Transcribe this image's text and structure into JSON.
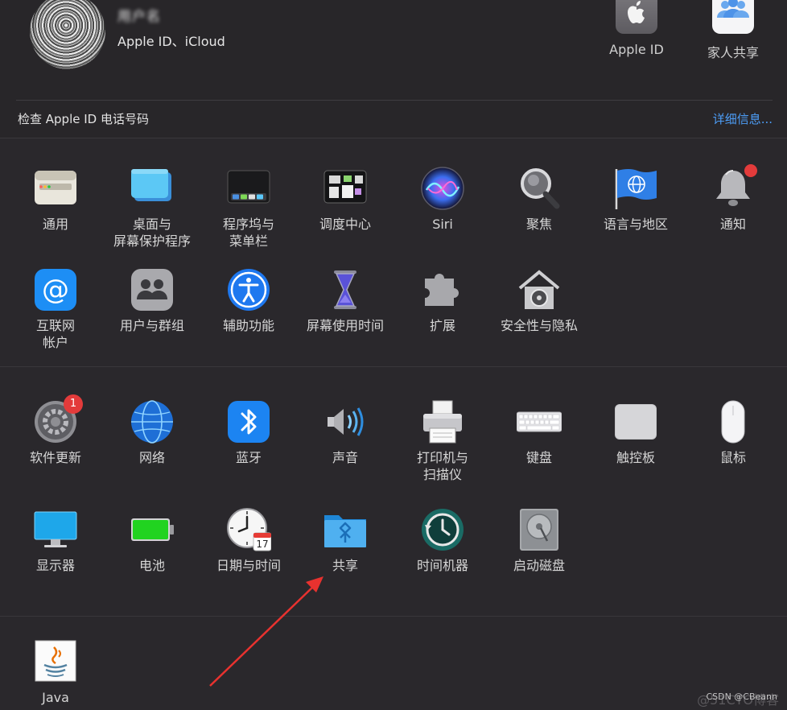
{
  "header": {
    "user_name": "用户名",
    "user_subtitle": "Apple ID、iCloud",
    "apple_id_label": "Apple ID",
    "family_label": "家人共享",
    "check_text": "检查 Apple ID 电话号码",
    "details_link": "详细信息..."
  },
  "prefs": {
    "general": "通用",
    "desktop_line1": "桌面与",
    "desktop_line2": "屏幕保护程序",
    "dock_line1": "程序坞与",
    "dock_line2": "菜单栏",
    "mission_control": "调度中心",
    "siri": "Siri",
    "spotlight": "聚焦",
    "language_region": "语言与地区",
    "notifications": "通知",
    "internet_line1": "互联网",
    "internet_line2": "帐户",
    "users_groups": "用户与群组",
    "accessibility": "辅助功能",
    "screen_time": "屏幕使用时间",
    "extensions": "扩展",
    "security_privacy": "安全性与隐私",
    "software_update": "软件更新",
    "software_update_badge": "1",
    "network": "网络",
    "bluetooth": "蓝牙",
    "sound": "声音",
    "printers_line1": "打印机与",
    "printers_line2": "扫描仪",
    "keyboard": "键盘",
    "trackpad": "触控板",
    "mouse": "鼠标",
    "displays": "显示器",
    "battery": "电池",
    "date_time": "日期与时间",
    "date_time_day": "17",
    "sharing": "共享",
    "time_machine": "时间机器",
    "startup_disk": "启动磁盘",
    "java": "Java"
  },
  "watermark": {
    "text": "CSDN @CBeann",
    "bg_text": "@51CTO博客"
  },
  "colors": {
    "background": "#2a282c",
    "link": "#4d9ef8",
    "badge": "#e33b3b",
    "arrow": "#e8322f"
  }
}
